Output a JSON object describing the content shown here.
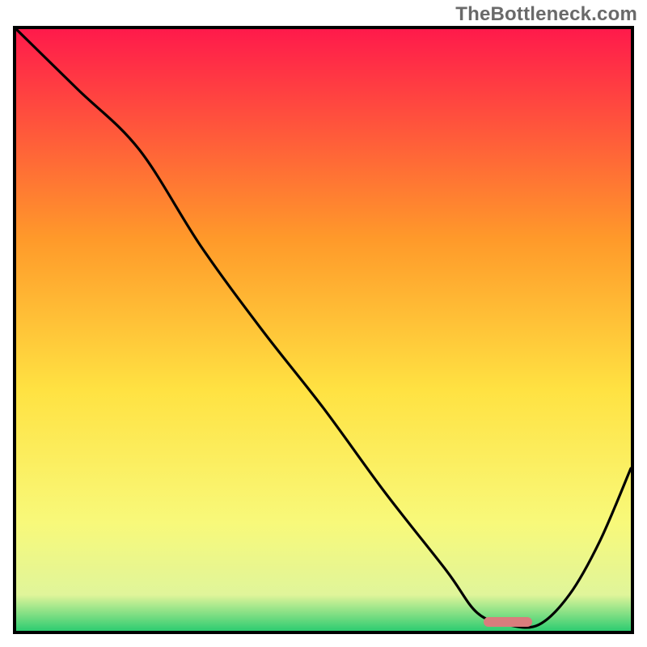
{
  "watermark": "TheBottleneck.com",
  "colors": {
    "top": "#ff1a4b",
    "mid_upper": "#ff9a2a",
    "mid": "#ffe242",
    "mid_lower": "#f8f97a",
    "near_bottom": "#e0f59a",
    "bottom": "#2ecc71",
    "curve": "#000000",
    "marker": "#d97d7d",
    "frame": "#000000"
  },
  "chart_data": {
    "type": "line",
    "title": "",
    "xlabel": "",
    "ylabel": "",
    "xlim": [
      0,
      100
    ],
    "ylim": [
      0,
      100
    ],
    "grid": false,
    "legend": false,
    "series": [
      {
        "name": "bottleneck-curve",
        "x": [
          0,
          10,
          20,
          30,
          40,
          50,
          60,
          70,
          75,
          80,
          85,
          90,
          95,
          100
        ],
        "y": [
          100,
          90,
          80,
          64,
          50,
          37,
          23,
          10,
          3,
          1,
          1,
          6,
          15,
          27
        ]
      }
    ],
    "annotations": [
      {
        "name": "optimal-range-marker",
        "x_start": 76,
        "x_end": 84,
        "y": 1.5
      }
    ],
    "note": "Axis values are estimated from pixel positions; the image has no tick labels."
  }
}
